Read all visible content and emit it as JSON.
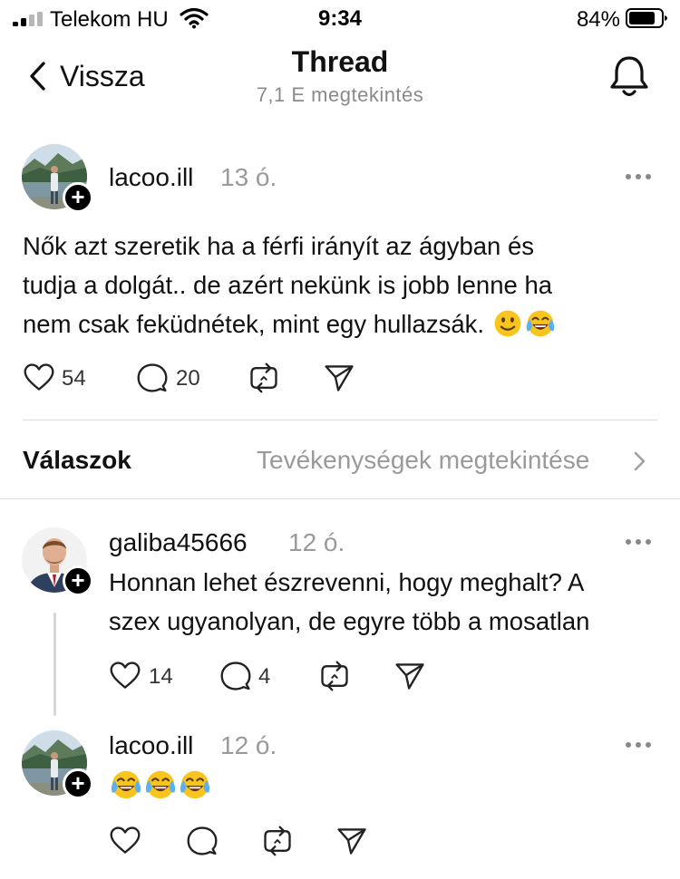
{
  "status_bar": {
    "carrier": "Telekom HU",
    "time": "9:34",
    "battery": "84%"
  },
  "header": {
    "back_label": "Vissza",
    "title": "Thread",
    "views": "7,1 E megtekintés"
  },
  "main_post": {
    "username": "lacoo.ill",
    "time": "13 ó.",
    "lines": [
      "Nők azt szeretik ha a férfi irányít az ágyban és",
      "tudja a dolgát.. de azért nekünk is jobb lenne ha",
      "nem csak feküdnétek, mint egy hullazsák."
    ],
    "emojis": [
      "slightly-smiling-face",
      "face-with-tears-of-joy"
    ],
    "likes": "54",
    "comments": "20"
  },
  "replies_bar": {
    "label": "Válaszok",
    "activity": "Tevékenységek megtekintése"
  },
  "replies": [
    {
      "username": "galiba45666",
      "time": "12 ó.",
      "lines": [
        "Honnan lehet észrevenni, hogy meghalt? A",
        "szex ugyanolyan, de egyre több a mosatlan"
      ],
      "likes": "14",
      "comments": "4"
    },
    {
      "username": "lacoo.ill",
      "time": "12 ó.",
      "emojis": [
        "face-with-tears-of-joy",
        "face-with-tears-of-joy",
        "face-with-tears-of-joy"
      ]
    }
  ],
  "colors": {
    "text": "#111111",
    "muted": "#9a9a9a",
    "divider": "#dcdcdc",
    "emoji_yellow": "#f7c51e"
  }
}
